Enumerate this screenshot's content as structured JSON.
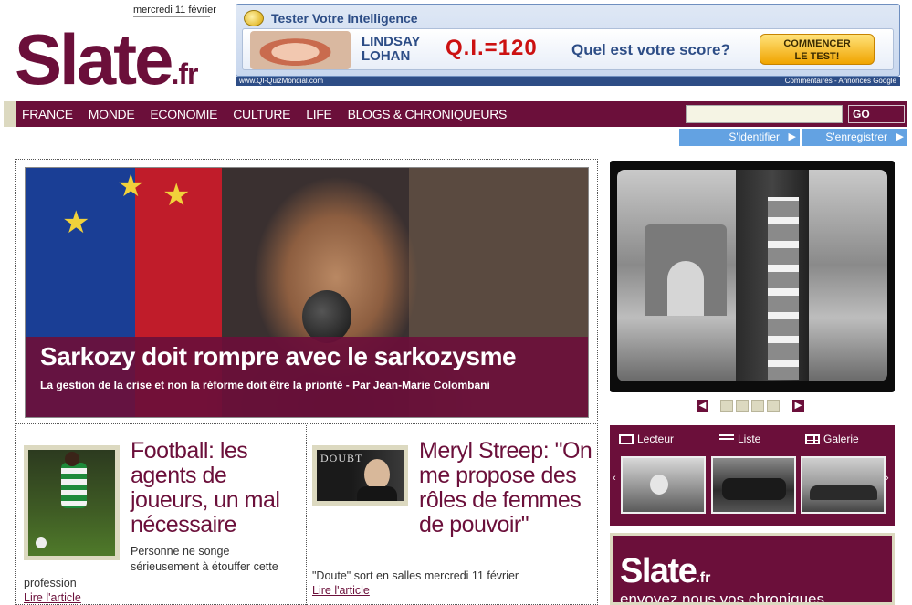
{
  "header": {
    "date": "mercredi 11 février",
    "logo_main": "Slate",
    "logo_suffix": ".fr"
  },
  "ad": {
    "headline": "Tester Votre Intelligence",
    "name_line1": "LINDSAY",
    "name_line2": "LOHAN",
    "qi": "Q.I.=120",
    "question": "Quel est votre score?",
    "cta_line1": "COMMENCER",
    "cta_line2": "LE TEST!",
    "source_url": "www.QI-QuizMondial.com",
    "attribution": "Commentaires - Annonces Google"
  },
  "nav": {
    "items": [
      "FRANCE",
      "MONDE",
      "ECONOMIE",
      "CULTURE",
      "LIFE",
      "BLOGS & CHRONIQUEURS"
    ]
  },
  "search": {
    "placeholder": "",
    "button": "GO"
  },
  "account": {
    "login": "S'identifier",
    "register": "S'enregistrer"
  },
  "feature": {
    "title": "Sarkozy doit rompre avec le sarkozysme",
    "subtitle": "La gestion de la crise et non la réforme doit être la priorité - Par Jean-Marie Colombani"
  },
  "articles": [
    {
      "title": "Football: les agents de joueurs, un mal nécessaire",
      "teaser_line1": "Personne ne songe",
      "teaser_line2": "sérieusement à étouffer cette",
      "teaser_line3": "profession",
      "link": "Lire l'article"
    },
    {
      "title": "Meryl Streep: \"On me propose des rôles de femmes de pouvoir\"",
      "thumb_text": "DOUBT",
      "teaser": "\"Doute\" sort en salles mercredi 11 février",
      "link": "Lire l'article"
    }
  ],
  "gallery": {
    "tabs": [
      "Lecteur",
      "Liste",
      "Galerie"
    ],
    "pages": 4
  },
  "promo": {
    "logo_main": "Slate",
    "logo_suffix": ".fr",
    "text": "envoyez nous vos chroniques ..."
  },
  "colors": {
    "brand": "#6b0f3a",
    "accent_blue": "#63a2e2",
    "beige": "#dcd9c0"
  }
}
